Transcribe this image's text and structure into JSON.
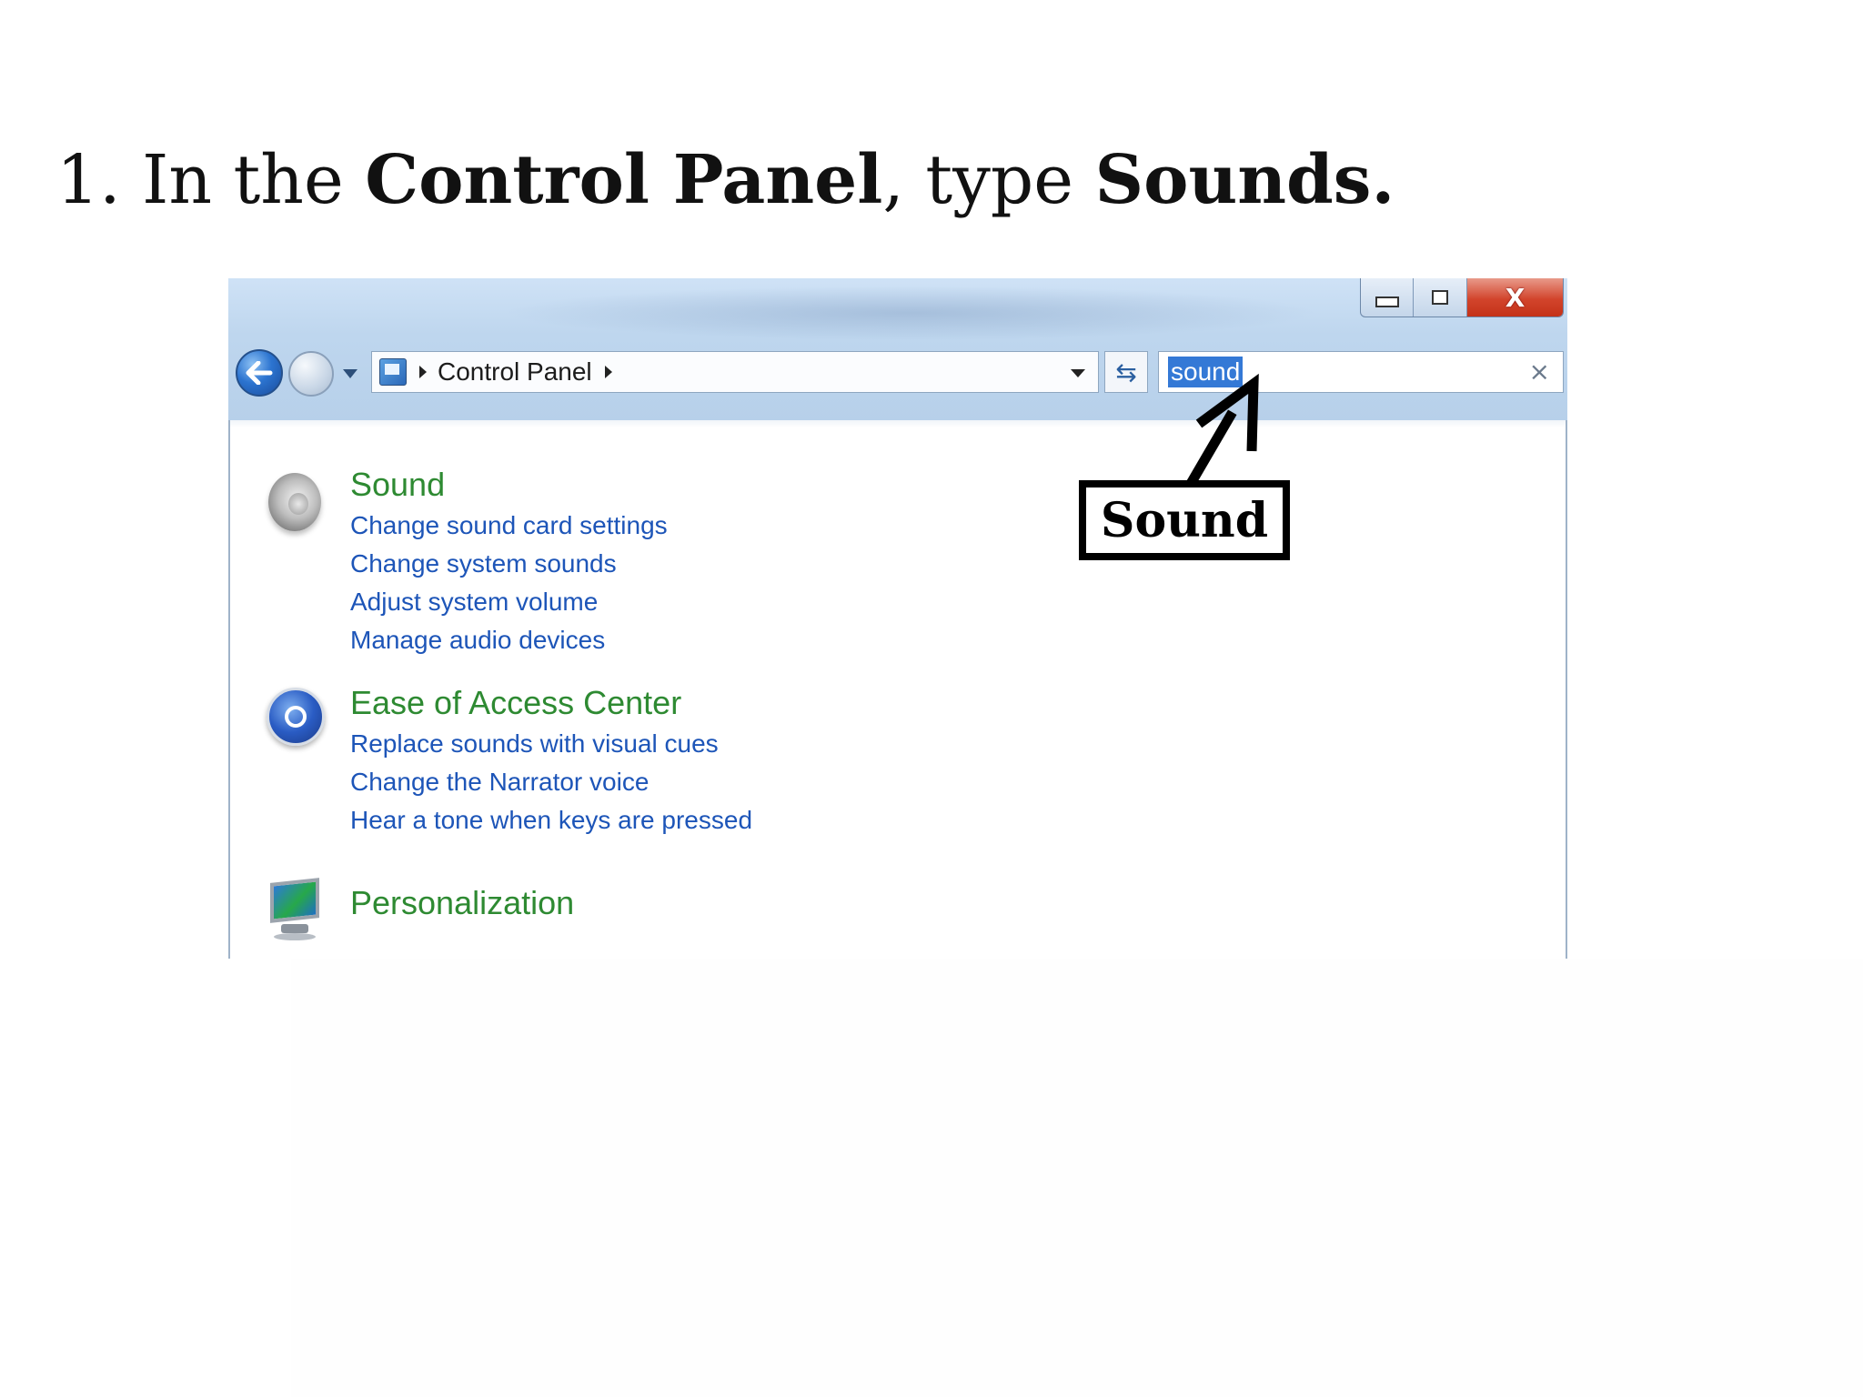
{
  "slide": {
    "step": "1.",
    "text_1": "In the",
    "bold_1": "Control Panel",
    "text_2": ", type",
    "bold_2": "Sounds."
  },
  "window": {
    "close_label": "X",
    "breadcrumb": "Control Panel",
    "search_value": "sound",
    "search_clear": "×"
  },
  "results": [
    {
      "title": "Sound",
      "icon": "speaker-icon",
      "links": [
        "Change sound card settings",
        "Change system sounds",
        "Adjust system volume",
        "Manage audio devices"
      ]
    },
    {
      "title": "Ease of Access Center",
      "icon": "ease-of-access-icon",
      "links": [
        "Replace sounds with visual cues",
        "Change the Narrator voice",
        "Hear a tone when keys are pressed"
      ]
    },
    {
      "title": "Personalization",
      "icon": "monitor-icon",
      "links": []
    }
  ],
  "callout": {
    "label": "Sound"
  },
  "colors": {
    "result_title": "#2e8a32",
    "result_link": "#1d55b8",
    "search_highlight": "#3479d6"
  }
}
